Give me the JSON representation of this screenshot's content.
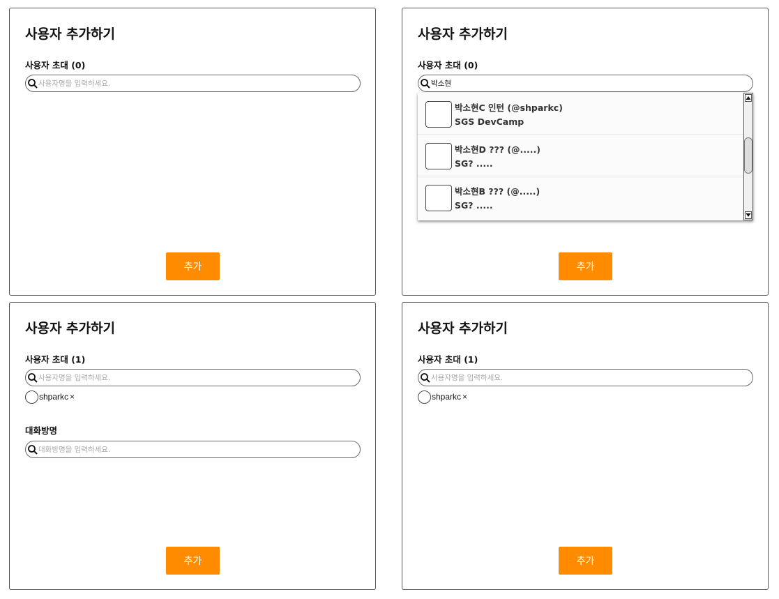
{
  "colors": {
    "accent": "#ff8c00",
    "border": "#555555",
    "placeholder": "#aaaaaa"
  },
  "panels": [
    {
      "title": "사용자 추가하기",
      "invite_label": "사용자 초대 (0)",
      "search": {
        "value": "",
        "placeholder": "사용자명을 입력하세요."
      },
      "add_button": "추가"
    },
    {
      "title": "사용자 추가하기",
      "invite_label": "사용자 초대 (0)",
      "search": {
        "value": "박소현",
        "placeholder": "사용자명을 입력하세요."
      },
      "results": [
        {
          "name": "박소현C 인턴 (@shparkc)",
          "org": "SGS DevCamp"
        },
        {
          "name": "박소현D ??? (@.....)",
          "org": "SG? ....."
        },
        {
          "name": "박소현B ??? (@.....)",
          "org": "SG? ....."
        }
      ],
      "add_button": "추가"
    },
    {
      "title": "사용자 추가하기",
      "invite_label": "사용자 초대 (1)",
      "search": {
        "value": "",
        "placeholder": "사용자명을 입력하세요."
      },
      "selected_users": [
        {
          "name": "shparkc",
          "remove": "×"
        }
      ],
      "room_label": "대화방명",
      "room": {
        "value": "",
        "placeholder": "대화방명을 입력하세요."
      },
      "add_button": "추가"
    },
    {
      "title": "사용자 추가하기",
      "invite_label": "사용자 초대 (1)",
      "search": {
        "value": "",
        "placeholder": "사용자명을 입력하세요."
      },
      "selected_users": [
        {
          "name": "shparkc",
          "remove": "×"
        }
      ],
      "add_button": "추가"
    }
  ]
}
